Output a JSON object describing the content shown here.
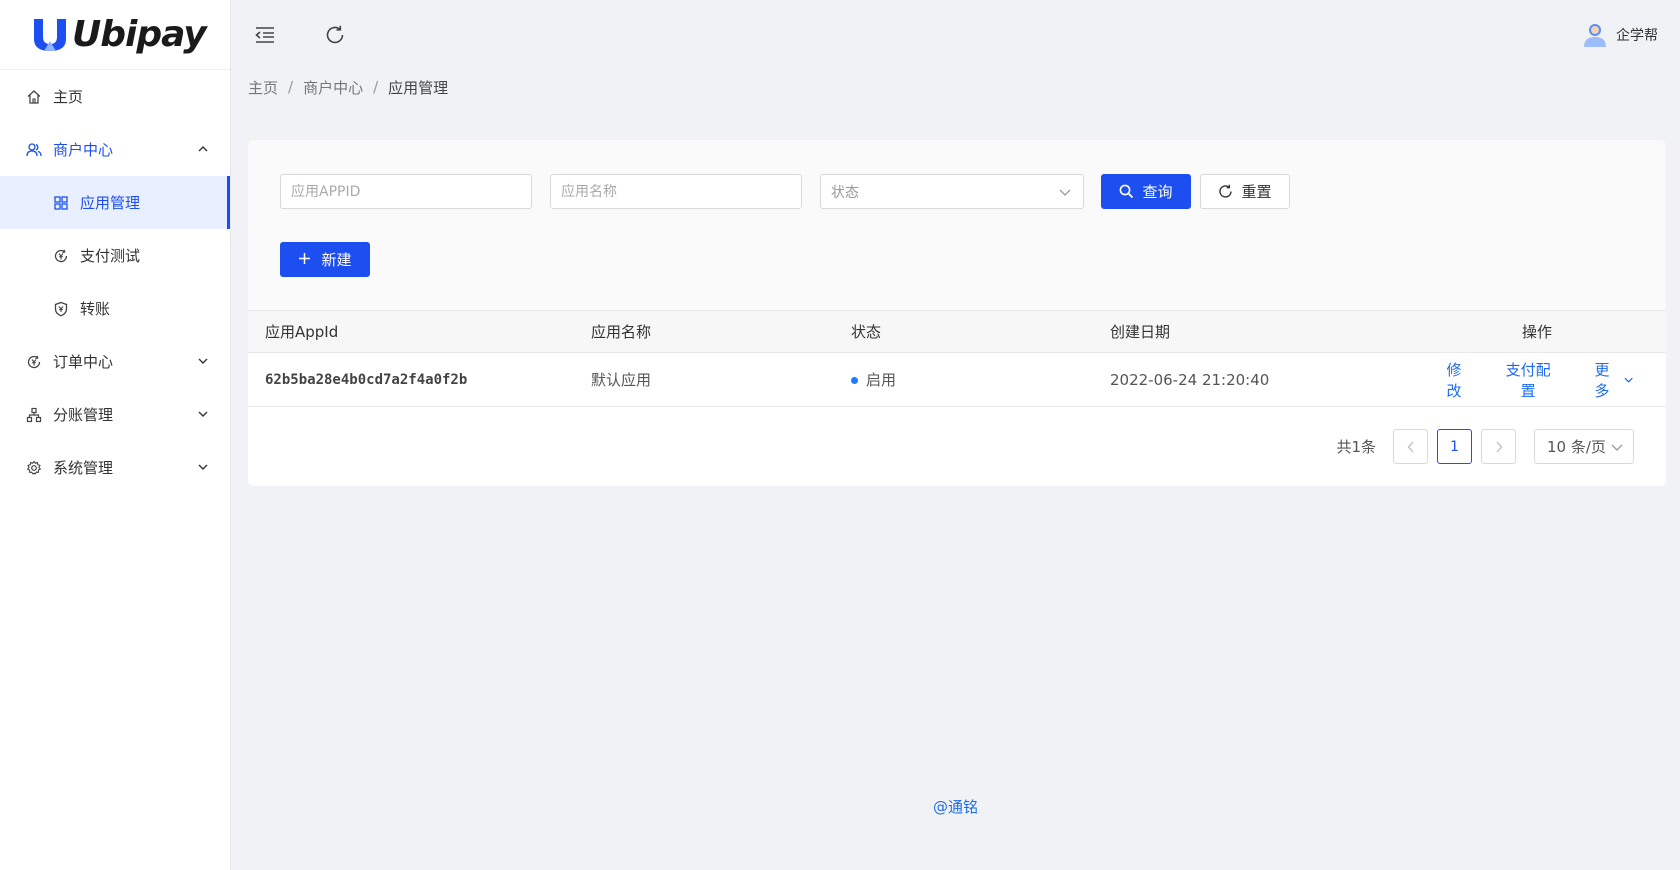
{
  "brand": {
    "name": "Ubipay",
    "accent": "#1d4ff0"
  },
  "topbar": {
    "collapse_icon": "menu-fold-icon",
    "refresh_icon": "refresh-icon"
  },
  "user": {
    "name": "企学帮",
    "icon": "user-avatar-icon"
  },
  "sidebar": {
    "items": [
      {
        "label": "主页",
        "icon": "home-icon"
      },
      {
        "label": "商户中心",
        "icon": "users-icon",
        "expanded": true,
        "children": [
          {
            "label": "应用管理",
            "icon": "grid-icon",
            "active": true
          },
          {
            "label": "支付测试",
            "icon": "yen-cycle-icon"
          },
          {
            "label": "转账",
            "icon": "yen-shield-icon"
          }
        ]
      },
      {
        "label": "订单中心",
        "icon": "yen-cycle-icon"
      },
      {
        "label": "分账管理",
        "icon": "tree-icon"
      },
      {
        "label": "系统管理",
        "icon": "gear-icon"
      }
    ]
  },
  "breadcrumb": [
    "主页",
    "商户中心",
    "应用管理"
  ],
  "filters": {
    "appid_placeholder": "应用APPID",
    "name_placeholder": "应用名称",
    "status_placeholder": "状态",
    "search_label": "查询",
    "reset_label": "重置"
  },
  "new_label": "新建",
  "table": {
    "headers": [
      "应用AppId",
      "应用名称",
      "状态",
      "创建日期",
      "操作"
    ],
    "rows": [
      {
        "appid": "62b5ba28e4b0cd7a2f4a0f2b",
        "name": "默认应用",
        "status": "启用",
        "created": "2022-06-24 21:20:40",
        "actions": [
          "修改",
          "支付配置",
          "更多"
        ]
      }
    ]
  },
  "pagination": {
    "total": "共1条",
    "current": "1",
    "page_size": "10 条/页"
  },
  "footer": "@通铭"
}
